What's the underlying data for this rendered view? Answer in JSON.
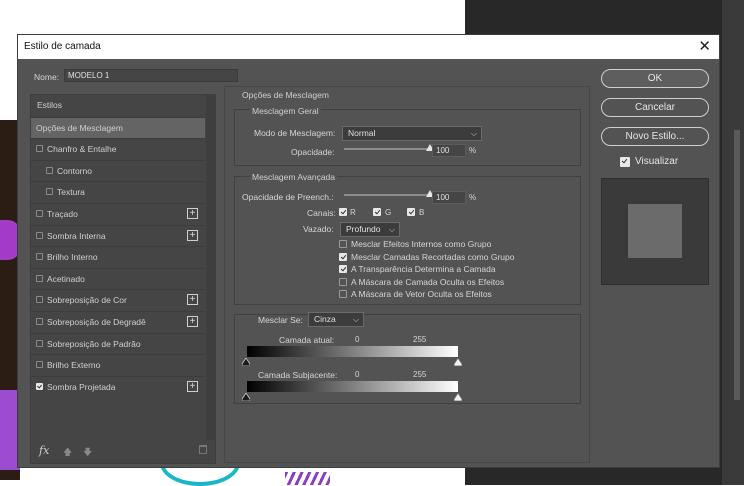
{
  "dialog": {
    "title": "Estilo de camada",
    "nome_label": "Nome:",
    "nome_value": "MODELO 1"
  },
  "styles_list": {
    "header": "Estilos",
    "items": [
      {
        "label": "Opções de Mesclagem",
        "checkbox": false,
        "checked": false,
        "plus": false,
        "selected": true,
        "indent": 0
      },
      {
        "label": "Chanfro & Entalhe",
        "checkbox": true,
        "checked": false,
        "plus": false,
        "selected": false,
        "indent": 0
      },
      {
        "label": "Contorno",
        "checkbox": true,
        "checked": false,
        "plus": false,
        "selected": false,
        "indent": 1
      },
      {
        "label": "Textura",
        "checkbox": true,
        "checked": false,
        "plus": false,
        "selected": false,
        "indent": 1
      },
      {
        "label": "Traçado",
        "checkbox": true,
        "checked": false,
        "plus": true,
        "selected": false,
        "indent": 0
      },
      {
        "label": "Sombra Interna",
        "checkbox": true,
        "checked": false,
        "plus": true,
        "selected": false,
        "indent": 0
      },
      {
        "label": "Brilho Interno",
        "checkbox": true,
        "checked": false,
        "plus": false,
        "selected": false,
        "indent": 0
      },
      {
        "label": "Acetinado",
        "checkbox": true,
        "checked": false,
        "plus": false,
        "selected": false,
        "indent": 0
      },
      {
        "label": "Sobreposição de Cor",
        "checkbox": true,
        "checked": false,
        "plus": true,
        "selected": false,
        "indent": 0
      },
      {
        "label": "Sobreposição de Degradê",
        "checkbox": true,
        "checked": false,
        "plus": true,
        "selected": false,
        "indent": 0
      },
      {
        "label": "Sobreposição de Padrão",
        "checkbox": true,
        "checked": false,
        "plus": false,
        "selected": false,
        "indent": 0
      },
      {
        "label": "Brilho Externo",
        "checkbox": true,
        "checked": false,
        "plus": false,
        "selected": false,
        "indent": 0
      },
      {
        "label": "Sombra Projetada",
        "checkbox": true,
        "checked": true,
        "plus": true,
        "selected": false,
        "indent": 0
      }
    ],
    "fx_label": "fx",
    "icons": [
      "fx-icon",
      "arrow-up-icon",
      "arrow-down-icon",
      "trash-icon"
    ]
  },
  "blending": {
    "section_title": "Opções de Mesclagem",
    "general": {
      "title": "Mesclagem Geral",
      "mode_label": "Modo de Mesclagem:",
      "mode_value": "Normal",
      "opacity_label": "Opacidade:",
      "opacity_value": "100",
      "opacity_percent": 100,
      "opacity_unit": "%"
    },
    "advanced": {
      "title": "Mesclagem Avançada",
      "fill_label": "Opacidade de Preench.:",
      "fill_value": "100",
      "fill_percent": 100,
      "fill_unit": "%",
      "channels_label": "Canais:",
      "channel_r": "R",
      "channel_g": "G",
      "channel_b": "B",
      "knockout_label": "Vazado:",
      "knockout_value": "Profundo",
      "options": [
        {
          "label": "Mesclar Efeitos Internos como Grupo",
          "checked": false
        },
        {
          "label": "Mesclar Camadas Recortadas como Grupo",
          "checked": true
        },
        {
          "label": "A Transparência Determina a Camada",
          "checked": true
        },
        {
          "label": "A Máscara de Camada Oculta os Efeitos",
          "checked": false
        },
        {
          "label": "A Máscara de Vetor Oculta os Efeitos",
          "checked": false
        }
      ]
    },
    "blend_if": {
      "label": "Mesclar Se:",
      "value": "Cinza",
      "this_layer_label": "Camada atual:",
      "this_layer_min": "0",
      "this_layer_max": "255",
      "underlying_label": "Camada Subjacente:",
      "underlying_min": "0",
      "underlying_max": "255"
    }
  },
  "buttons": {
    "ok": "OK",
    "cancel": "Cancelar",
    "new_style": "Novo Estilo...",
    "preview_label": "Visualizar",
    "preview_checked": true
  },
  "colors": {
    "dialog_bg": "#535353",
    "panel_bg": "#454545",
    "selected_item": "#646464",
    "text": "#d6d6d6"
  }
}
